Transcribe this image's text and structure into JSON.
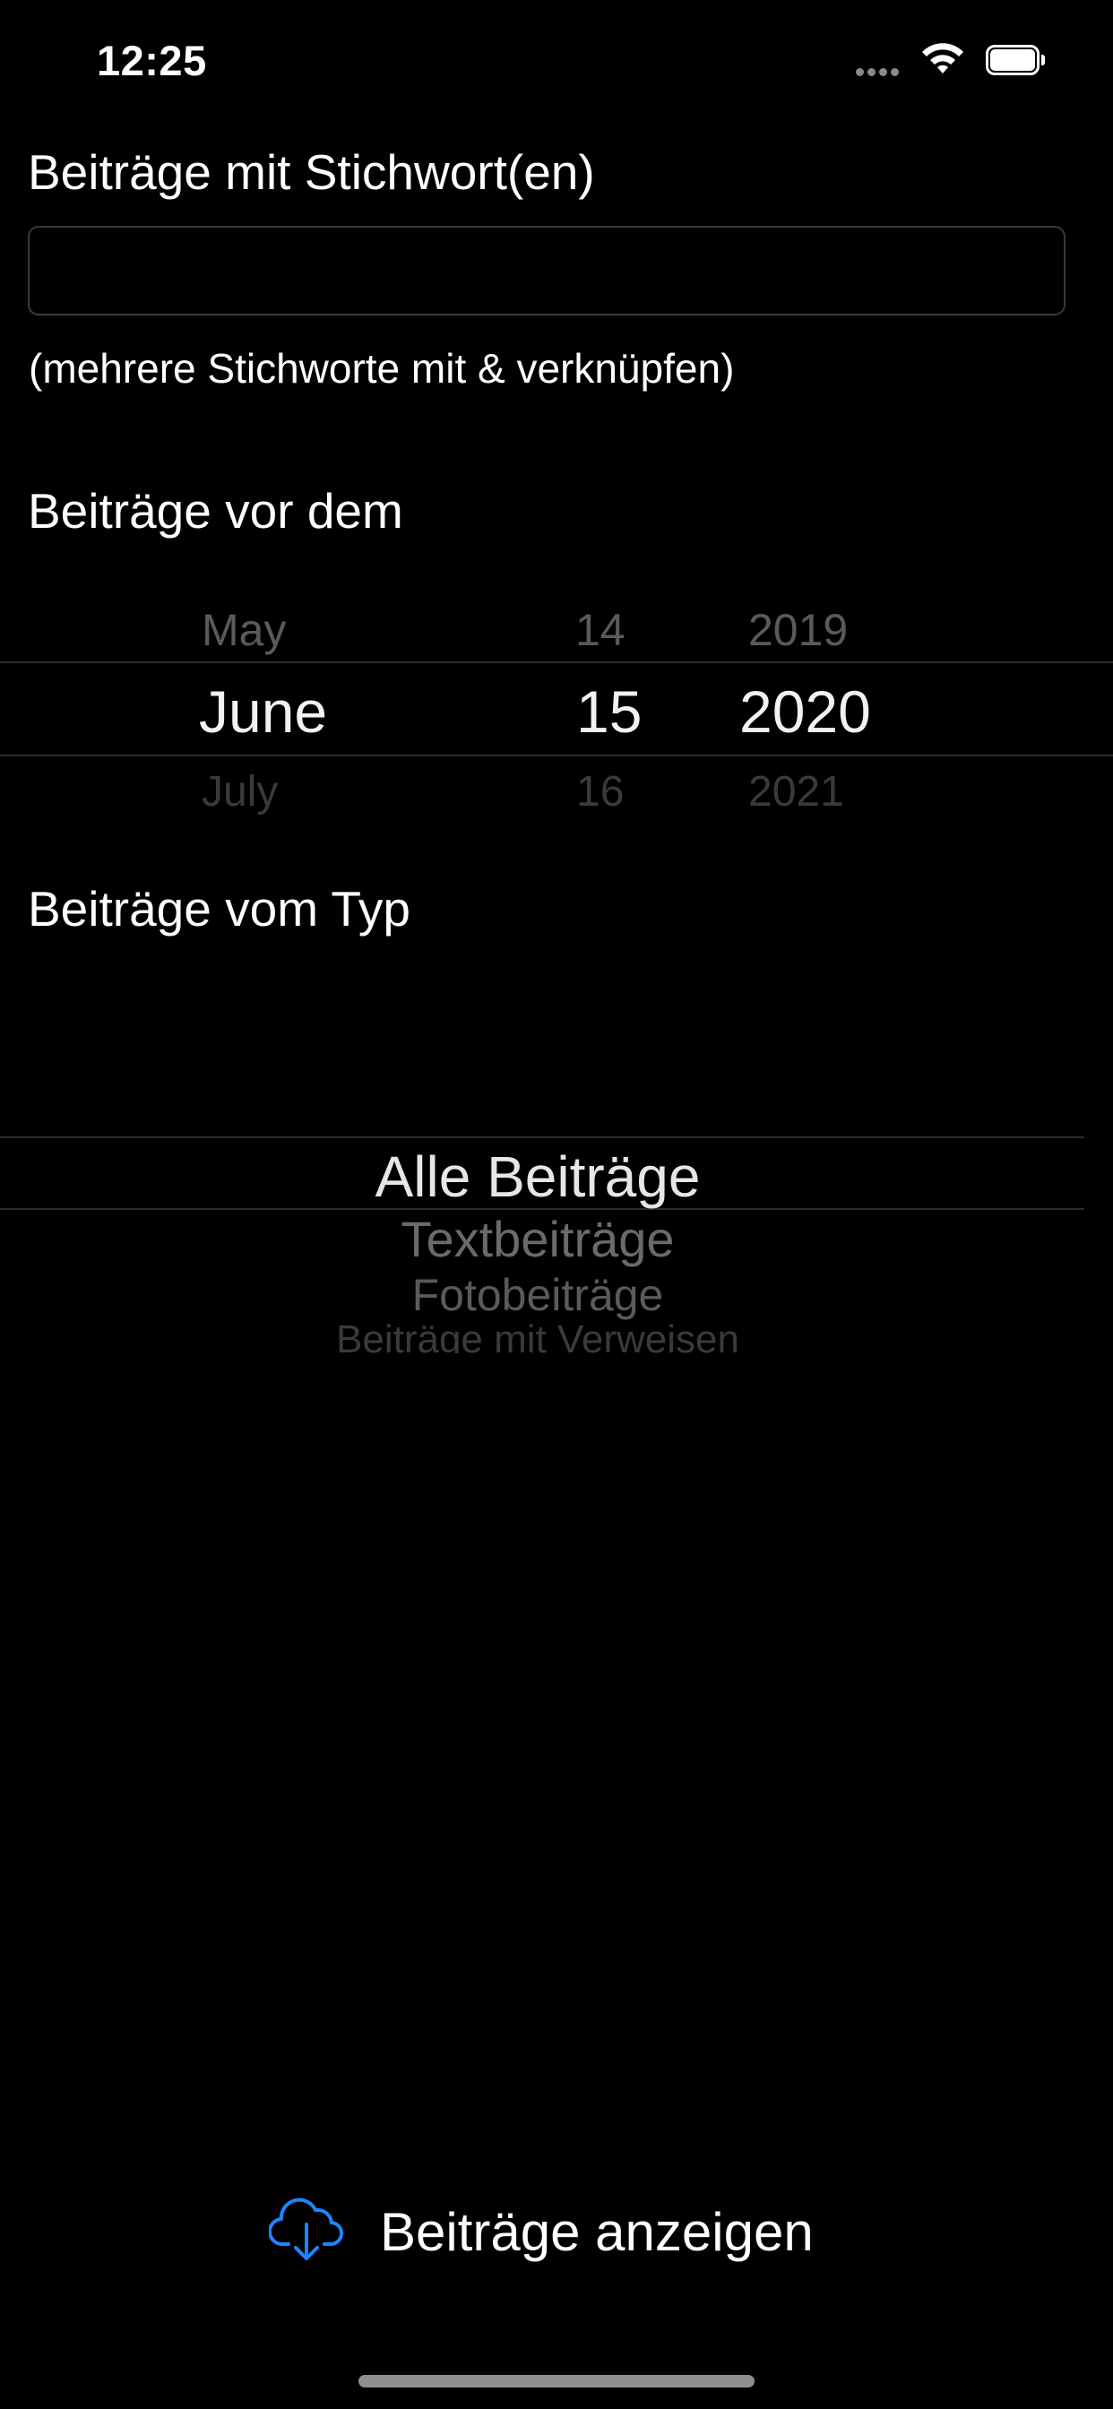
{
  "status_bar": {
    "time": "12:25"
  },
  "keyword": {
    "label": "Beiträge mit Stichwort(en)",
    "value": "",
    "placeholder": "",
    "hint": "(mehrere Stichworte mit & verknüpfen)"
  },
  "date": {
    "label": "Beiträge vor dem",
    "months": {
      "prev": "May",
      "selected": "June",
      "next": "July"
    },
    "days": {
      "prev": "14",
      "selected": "15",
      "next": "16"
    },
    "years": {
      "prev": "2019",
      "selected": "2020",
      "next": "2021"
    }
  },
  "type": {
    "label": "Beiträge vom Typ",
    "selected": "Alle Beiträge",
    "options_below": [
      "Textbeiträge",
      "Fotobeiträge",
      "Beiträge mit Verweisen"
    ]
  },
  "action": {
    "button_label": "Beiträge anzeigen",
    "icon": "cloud-download-icon",
    "icon_color": "#1f84ff"
  }
}
